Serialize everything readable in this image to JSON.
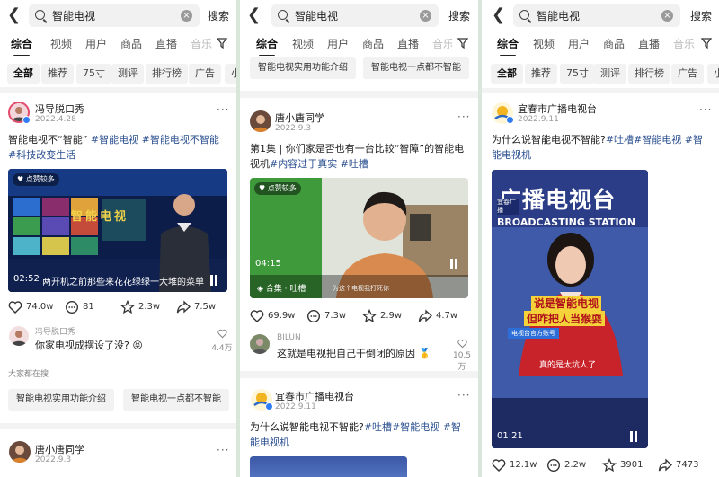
{
  "search": {
    "query": "智能电视",
    "button": "搜索"
  },
  "tabs": [
    "综合",
    "视频",
    "用户",
    "商品",
    "直播",
    "音乐"
  ],
  "chips": [
    "全部",
    "推荐",
    "75寸",
    "测评",
    "排行榜",
    "广告",
    "小"
  ],
  "related": [
    "智能电视实用功能介绍",
    "智能电视一点都不智能"
  ],
  "panel1": {
    "post": {
      "author": "冯导脱口秀",
      "date": "2022.4.28",
      "desc_text": "智能电视不“智能” ",
      "desc_tags": "#智能电视 #智能电视不智能 #科技改变生活",
      "video": {
        "badge": "点赞较多",
        "time": "02:52",
        "caption": "两开机之前那些来花花绿绿一大堆的菜单",
        "title_on_screen": "智能电视"
      },
      "stats": {
        "likes": "74.0w",
        "comments": "81",
        "favorites": "2.3w",
        "shares": "7.5w"
      },
      "comment": {
        "name": "冯导脱口秀",
        "text": "你家电视成摆设了没?",
        "emoji": "😝",
        "likes": "4.4万"
      }
    },
    "related_title": "大家都在搜",
    "next": {
      "author": "唐小唐同学",
      "date": "2022.9.3"
    }
  },
  "panel2": {
    "post": {
      "author": "唐小唐同学",
      "date": "2022.9.3",
      "desc_text": "第1集 | 你们家是否也有一台比较“智障”的智能电视机",
      "desc_tags": "#内容过于真实 #吐槽",
      "video": {
        "badge": "点赞较多",
        "time": "04:15",
        "collection": "合集 · 吐槽",
        "caption": "为这个电视我打死你"
      },
      "stats": {
        "likes": "69.9w",
        "comments": "7.3w",
        "favorites": "2.9w",
        "shares": "4.7w"
      },
      "comment": {
        "name": "BILUN",
        "text": "这就是电视把自己干倒闭的原因",
        "emoji": "🥇",
        "likes": "10.5万"
      }
    },
    "next": {
      "author": "宜春市广播电视台",
      "date": "2022.9.11",
      "desc_text": "为什么说智能电视不智能?",
      "desc_tags": "#吐槽#智能电视 #智能电视机"
    }
  },
  "panel3": {
    "post": {
      "author": "宜春市广播电视台",
      "date": "2022.9.11",
      "desc_text": "为什么说智能电视不智能?",
      "desc_tags": "#吐槽#智能电视 #智能电视机",
      "video": {
        "headline": "广播电视台",
        "sub": "BROADCASTING STATION",
        "station": "宜春广播",
        "caption1": "说是智能电视",
        "caption2": "但咋把人当猴耍",
        "caption3": "真的是太坑人了",
        "anchor_tag": "电视台官方账号",
        "time": "01:21"
      },
      "stats": {
        "likes": "12.1w",
        "comments": "2.2w",
        "favorites": "3901",
        "shares": "7473"
      }
    }
  },
  "colors": {
    "accent": "#2a4f8f",
    "page_bg": "#ffffff",
    "divider": "#f3f3f3",
    "frame": "#d9e6da"
  }
}
